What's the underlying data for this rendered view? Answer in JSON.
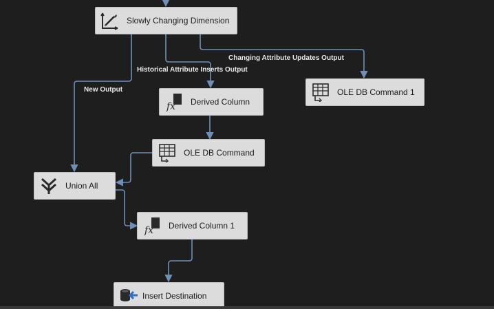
{
  "nodes": {
    "scd": {
      "label": "Slowly Changing Dimension",
      "icon": "slowly-changing-dimension-icon"
    },
    "derived_column": {
      "label": "Derived Column",
      "icon": "derived-column-fx-icon"
    },
    "ole_db_command_1": {
      "label": "OLE DB Command 1",
      "icon": "ole-db-command-icon"
    },
    "ole_db_command": {
      "label": "OLE DB Command",
      "icon": "ole-db-command-icon"
    },
    "union_all": {
      "label": "Union All",
      "icon": "union-all-icon"
    },
    "derived_column_1": {
      "label": "Derived Column 1",
      "icon": "derived-column-fx-icon"
    },
    "insert_destination": {
      "label": "Insert Destination",
      "icon": "database-destination-icon"
    }
  },
  "edges": {
    "changing_attribute_updates": "Changing Attribute Updates Output",
    "historical_attribute_inserts": "Historical Attribute Inserts Output",
    "new_output": "New Output"
  },
  "colors": {
    "background": "#1e1e1e",
    "node": "#dcdcdc",
    "wire": "#6f8fb7",
    "label": "#e8e8e8"
  }
}
